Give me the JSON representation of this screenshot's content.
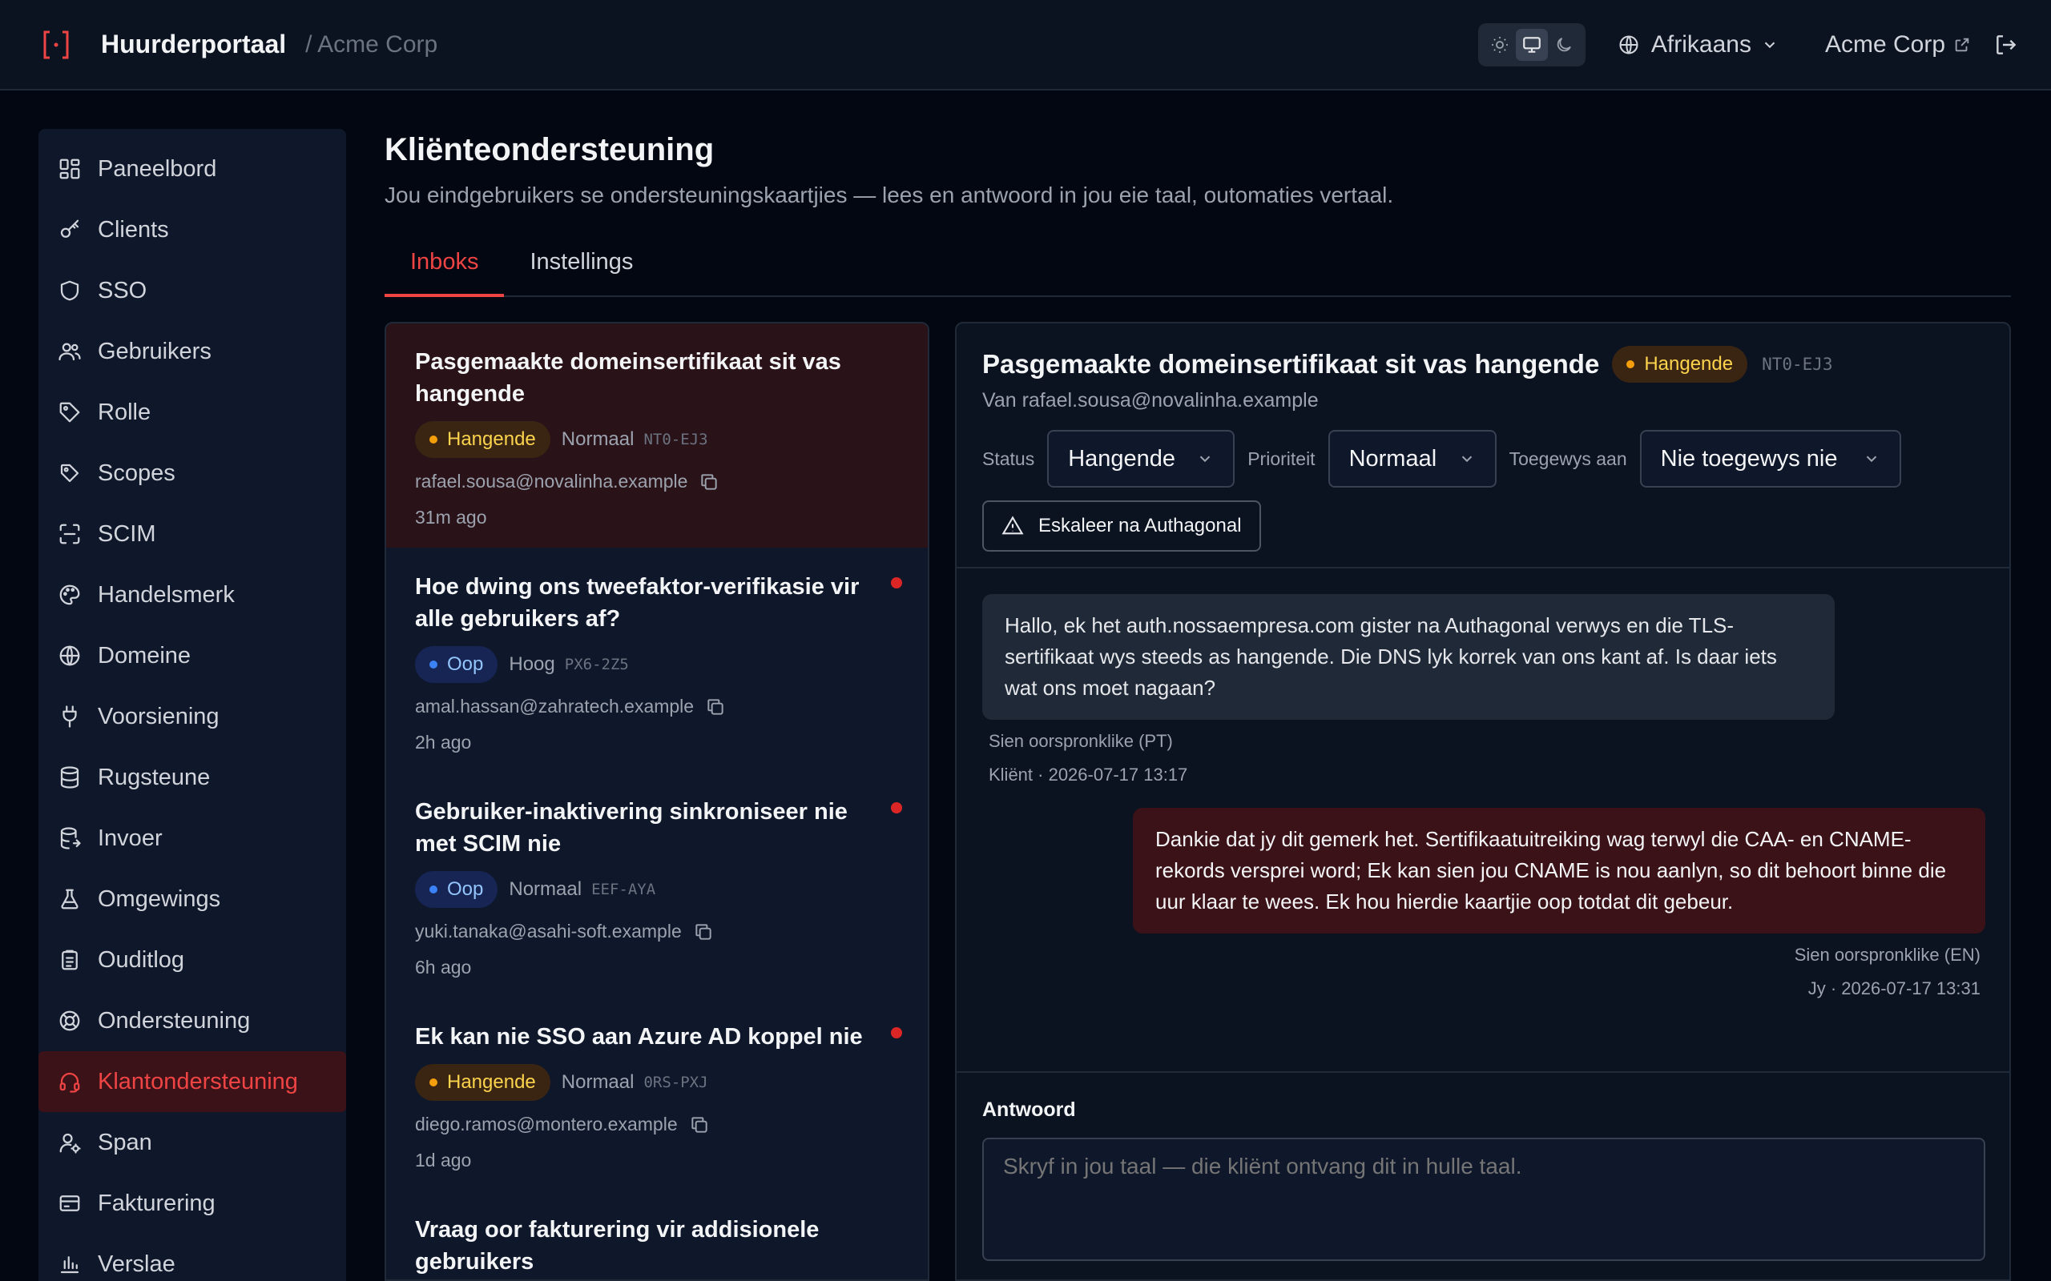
{
  "header": {
    "app_name": "Huurderportaal",
    "org_crumb": "/ Acme Corp",
    "language": "Afrikaans",
    "org_link": "Acme Corp"
  },
  "sidebar": {
    "items": [
      {
        "label": "Paneelbord",
        "icon": "dashboard-icon"
      },
      {
        "label": "Clients",
        "icon": "key-icon"
      },
      {
        "label": "SSO",
        "icon": "shield-icon"
      },
      {
        "label": "Gebruikers",
        "icon": "users-icon"
      },
      {
        "label": "Rolle",
        "icon": "tag-icon"
      },
      {
        "label": "Scopes",
        "icon": "tags-icon"
      },
      {
        "label": "SCIM",
        "icon": "scan-icon"
      },
      {
        "label": "Handelsmerk",
        "icon": "palette-icon"
      },
      {
        "label": "Domeine",
        "icon": "globe-icon"
      },
      {
        "label": "Voorsiening",
        "icon": "plug-icon"
      },
      {
        "label": "Rugsteune",
        "icon": "database-icon"
      },
      {
        "label": "Invoer",
        "icon": "database-import-icon"
      },
      {
        "label": "Omgewings",
        "icon": "flask-icon"
      },
      {
        "label": "Ouditlog",
        "icon": "clipboard-icon"
      },
      {
        "label": "Ondersteuning",
        "icon": "lifebuoy-icon"
      },
      {
        "label": "Klantondersteuning",
        "icon": "headset-icon"
      },
      {
        "label": "Span",
        "icon": "user-cog-icon"
      },
      {
        "label": "Fakturering",
        "icon": "credit-card-icon"
      },
      {
        "label": "Verslae",
        "icon": "bar-chart-icon"
      }
    ],
    "active_index": 15
  },
  "page": {
    "title": "Kliënteondersteuning",
    "subtitle": "Jou eindgebruikers se ondersteuningskaartjies — lees en antwoord in jou eie taal, outomaties vertaal.",
    "tabs": [
      "Inboks",
      "Instellings"
    ]
  },
  "tickets": [
    {
      "title": "Pasgemaakte domeinsertifikaat sit vas hangende",
      "status": "Hangende",
      "priority": "Normaal",
      "code": "NT0-EJ3",
      "email": "rafael.sousa@novalinha.example",
      "time": "31m ago"
    },
    {
      "title": "Hoe dwing ons tweefaktor-verifikasie vir alle gebruikers af?",
      "status": "Oop",
      "priority": "Hoog",
      "code": "PX6-2Z5",
      "email": "amal.hassan@zahratech.example",
      "time": "2h ago"
    },
    {
      "title": "Gebruiker-inaktivering sinkroniseer nie met SCIM nie",
      "status": "Oop",
      "priority": "Normaal",
      "code": "EEF-AYA",
      "email": "yuki.tanaka@asahi-soft.example",
      "time": "6h ago"
    },
    {
      "title": "Ek kan nie SSO aan Azure AD koppel nie",
      "status": "Hangende",
      "priority": "Normaal",
      "code": "0RS-PXJ",
      "email": "diego.ramos@montero.example",
      "time": "1d ago"
    },
    {
      "title": "Vraag oor fakturering vir addisionele gebruikers",
      "status": "",
      "priority": "",
      "code": "",
      "email": "",
      "time": ""
    }
  ],
  "detail": {
    "title": "Pasgemaakte domeinsertifikaat sit vas hangende",
    "status_badge": "Hangende",
    "code": "NT0-EJ3",
    "from": "Van rafael.sousa@novalinha.example",
    "status_label": "Status",
    "status_value": "Hangende",
    "priority_label": "Prioriteit",
    "priority_value": "Normaal",
    "assign_label": "Toegewys aan",
    "assign_value": "Nie toegewys nie",
    "escalate_label": "Eskaleer na Authagonal",
    "messages": [
      {
        "text": "Hallo, ek het auth.nossaempresa.com gister na Authagonal verwys en die TLS-sertifikaat wys steeds as hangende. Die DNS lyk korrek van ons kant af. Is daar iets wat ons moet nagaan?",
        "original": "Sien oorspronklike (PT)",
        "meta": "Kliënt · 2026-07-17 13:17"
      },
      {
        "text": "Dankie dat jy dit gemerk het. Sertifikaatuitreiking wag terwyl die CAA- en CNAME-rekords versprei word; Ek kan sien jou CNAME is nou aanlyn, so dit behoort binne die uur klaar te wees. Ek hou hierdie kaartjie oop totdat dit gebeur.",
        "original": "Sien oorspronklike (EN)",
        "meta": "Jy · 2026-07-17 13:31"
      }
    ],
    "reply_label": "Antwoord",
    "reply_placeholder": "Skryf in jou taal — die kliënt ontvang dit in hulle taal."
  }
}
